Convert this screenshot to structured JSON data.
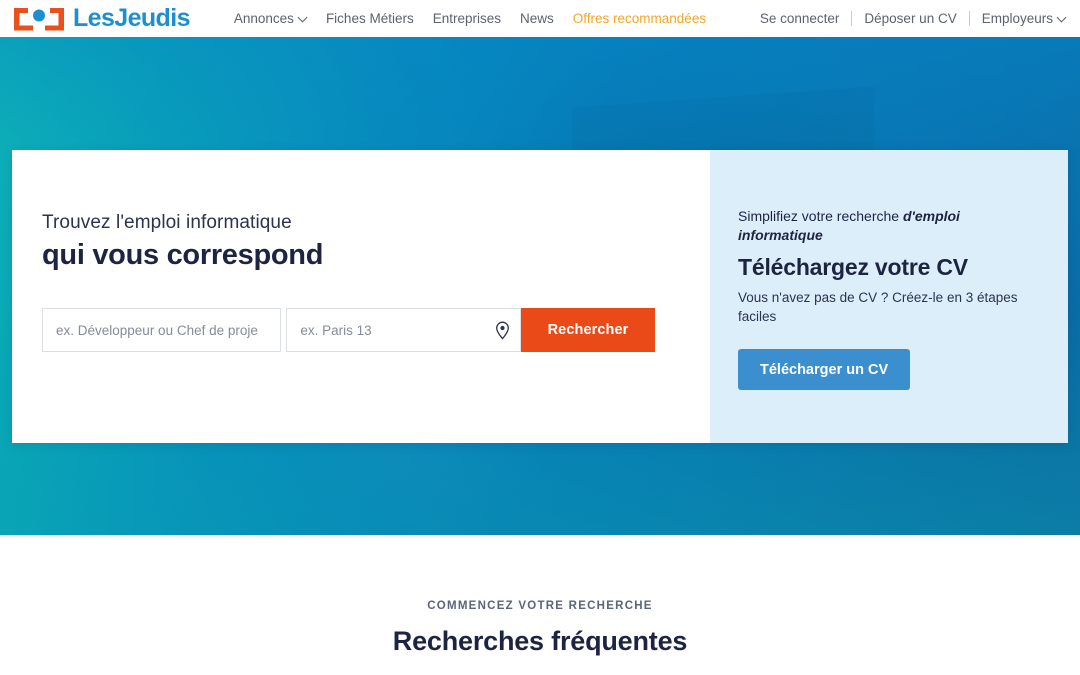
{
  "brand": {
    "name": "LesJeudis",
    "mark_icon": "brackets-dot-logo-icon",
    "logo_color": "#1d8fd1",
    "mark_color": "#e8501e",
    "mark_dot_color": "#1d8fd1"
  },
  "header": {
    "nav_main": [
      {
        "label": "Annonces",
        "has_caret": true,
        "accent": false
      },
      {
        "label": "Fiches Métiers",
        "has_caret": false,
        "accent": false
      },
      {
        "label": "Entreprises",
        "has_caret": false,
        "accent": false
      },
      {
        "label": "News",
        "has_caret": false,
        "accent": false
      },
      {
        "label": "Offres recommandées",
        "has_caret": false,
        "accent": true
      }
    ],
    "nav_right": [
      {
        "label": "Se connecter",
        "has_caret": false
      },
      {
        "label": "Déposer un CV",
        "has_caret": false
      },
      {
        "label": "Employeurs",
        "has_caret": true
      }
    ],
    "accent_color": "#f5a623"
  },
  "hero": {
    "title_light": "Trouvez l'emploi informatique",
    "title_bold": "qui vous correspond",
    "gradient_from": "#10c8b4",
    "gradient_to": "#0a76ba"
  },
  "search": {
    "keyword_placeholder": "ex. Développeur ou Chef de proje",
    "keyword_value": "",
    "location_placeholder": "ex. Paris 13",
    "location_value": "",
    "location_icon": "map-pin-icon",
    "submit_label": "Rechercher",
    "submit_color": "#ea4a18"
  },
  "cv_panel": {
    "kicker_prefix": "Simplifiez votre recherche ",
    "kicker_emphasis": "d'emploi informatique",
    "title": "Téléchargez votre CV",
    "subtitle": "Vous n'avez pas de CV ? Créez-le en 3 étapes faciles",
    "button_label": "Télécharger un CV",
    "button_color": "#3c8fce",
    "panel_color": "#ddeefb"
  },
  "frequent_searches": {
    "eyebrow": "COMMENCEZ VOTRE RECHERCHE",
    "title": "Recherches fréquentes"
  }
}
